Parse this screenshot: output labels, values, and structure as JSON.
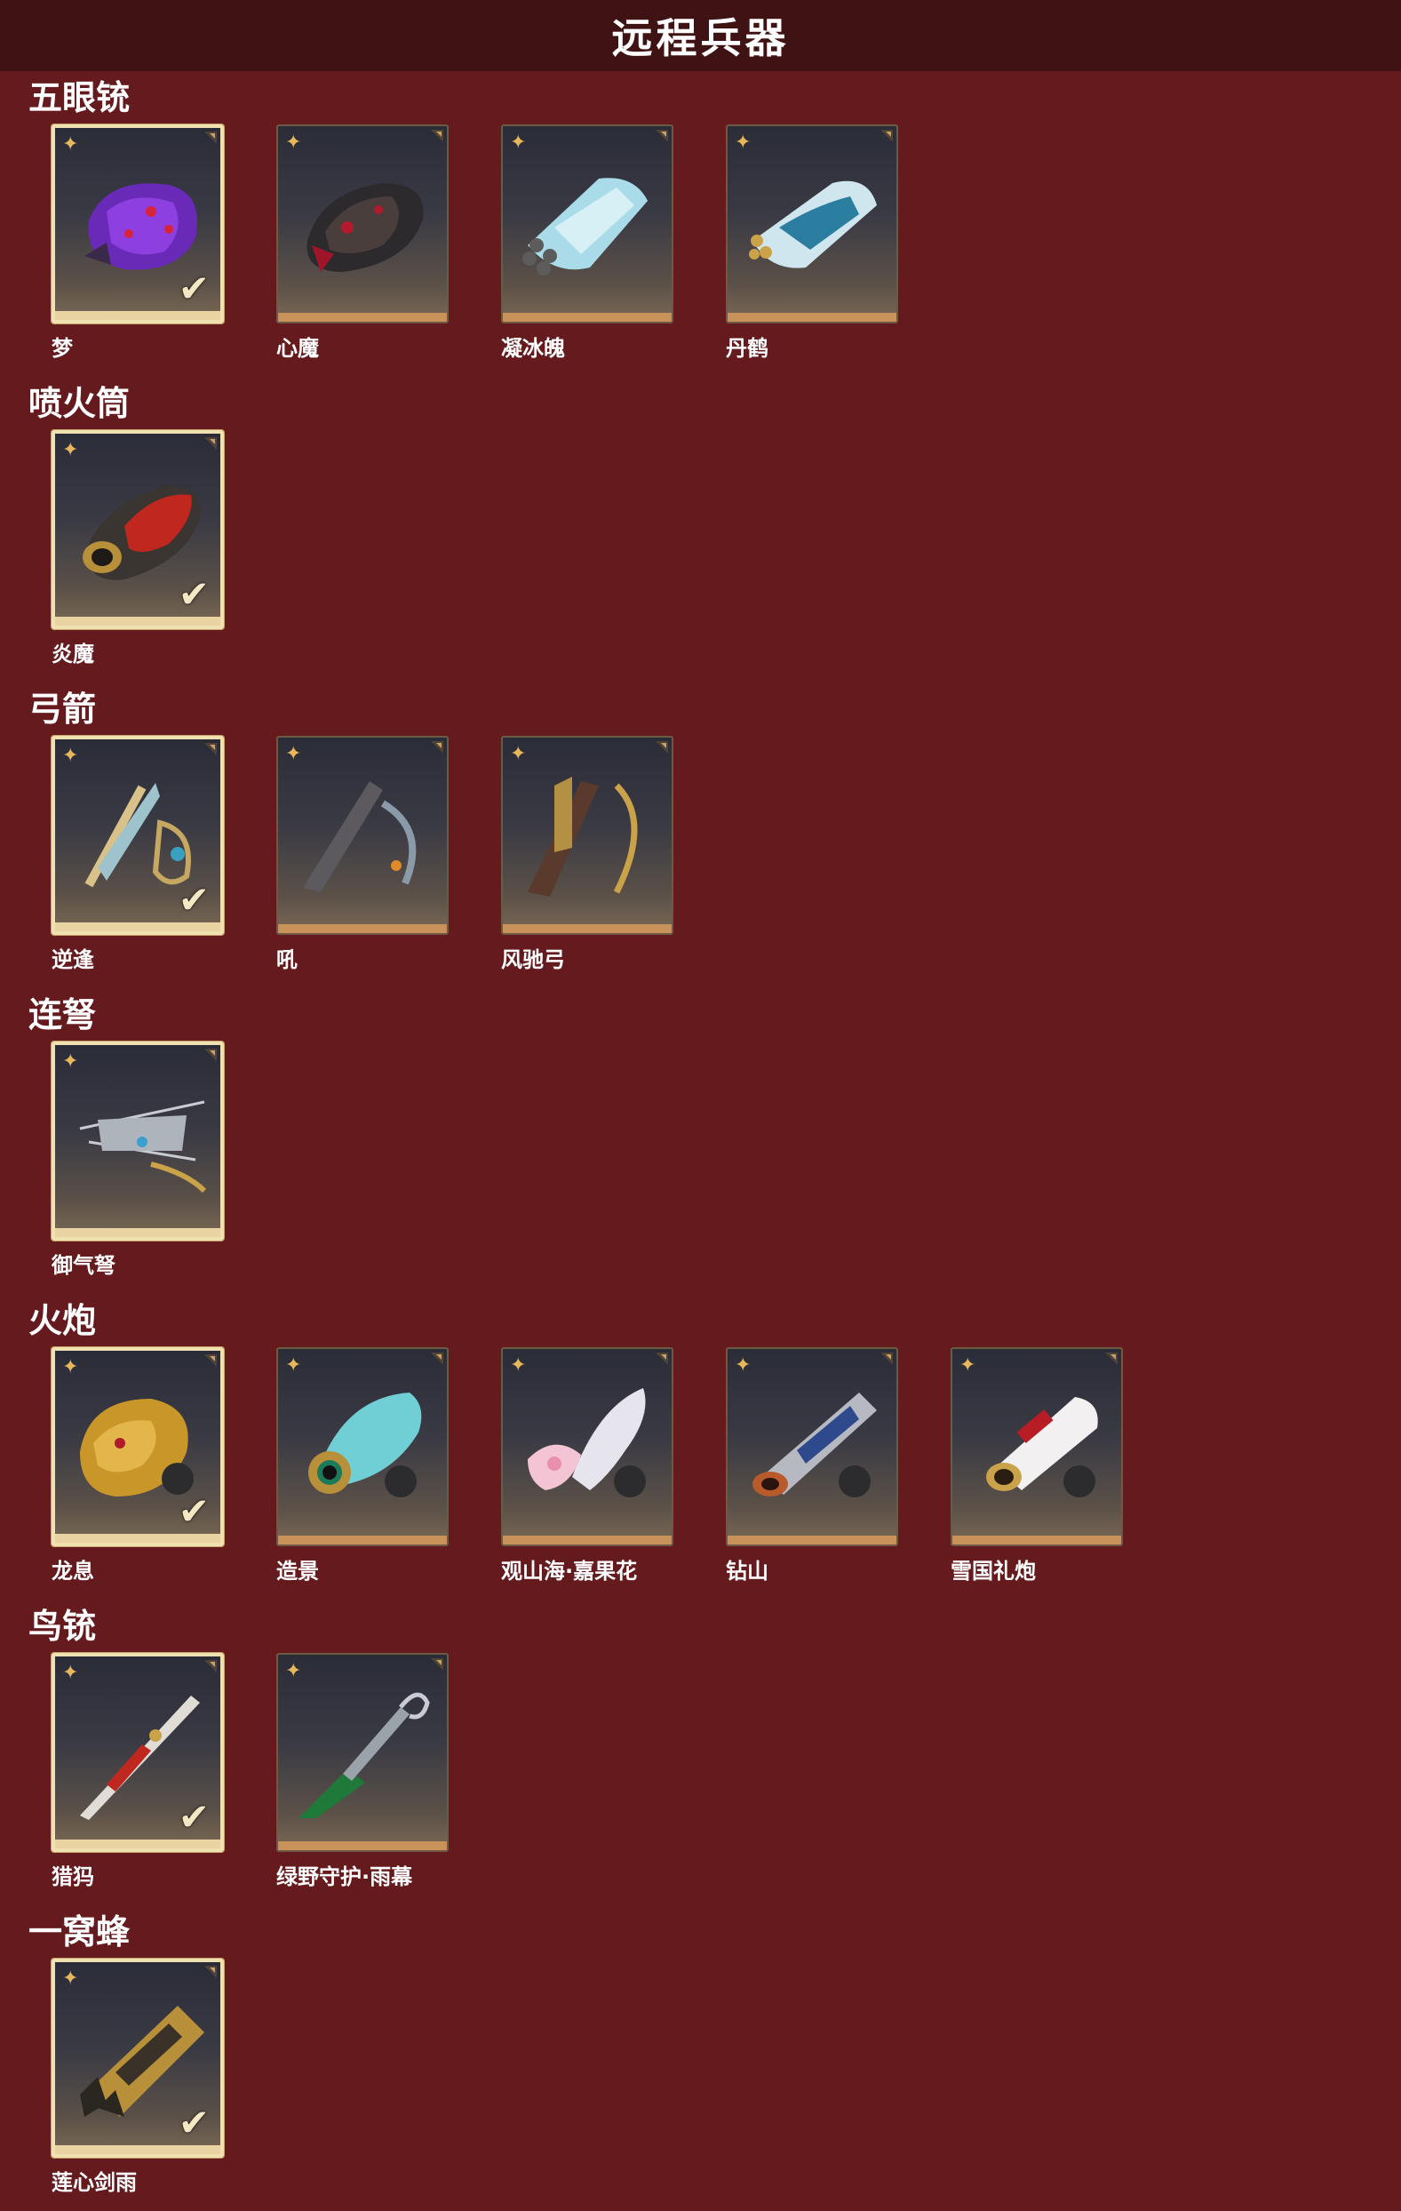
{
  "header": {
    "title": "远程兵器"
  },
  "sections": [
    {
      "title": "五眼铳",
      "items": [
        {
          "name": "梦",
          "owned": true
        },
        {
          "name": "心魔",
          "owned": false
        },
        {
          "name": "凝冰魄",
          "owned": false
        },
        {
          "name": "丹鹤",
          "owned": false
        }
      ]
    },
    {
      "title": "喷火筒",
      "items": [
        {
          "name": "炎魔",
          "owned": true
        }
      ]
    },
    {
      "title": "弓箭",
      "items": [
        {
          "name": "逆逢",
          "owned": true
        },
        {
          "name": "吼",
          "owned": false
        },
        {
          "name": "风驰弓",
          "owned": false
        }
      ]
    },
    {
      "title": "连弩",
      "items": [
        {
          "name": "御气弩",
          "owned": false
        }
      ]
    },
    {
      "title": "火炮",
      "items": [
        {
          "name": "龙息",
          "owned": true
        },
        {
          "name": "造景",
          "owned": false
        },
        {
          "name": "观山海·嘉果花",
          "owned": false
        },
        {
          "name": "钻山",
          "owned": false
        },
        {
          "name": "雪国礼炮",
          "owned": false
        }
      ]
    },
    {
      "title": "鸟铳",
      "items": [
        {
          "name": "猎犸",
          "owned": true
        },
        {
          "name": "绿野守护·雨幕",
          "owned": false
        }
      ]
    },
    {
      "title": "一窝蜂",
      "items": [
        {
          "name": "莲心剑雨",
          "owned": true
        }
      ]
    }
  ],
  "icons": {
    "star": "sparkle-icon",
    "check": "checkmark-icon"
  },
  "colors": {
    "background": "#651a1e",
    "header": "#3f1214",
    "owned_border": "#f1e0b0",
    "star": "#e6b85b"
  }
}
